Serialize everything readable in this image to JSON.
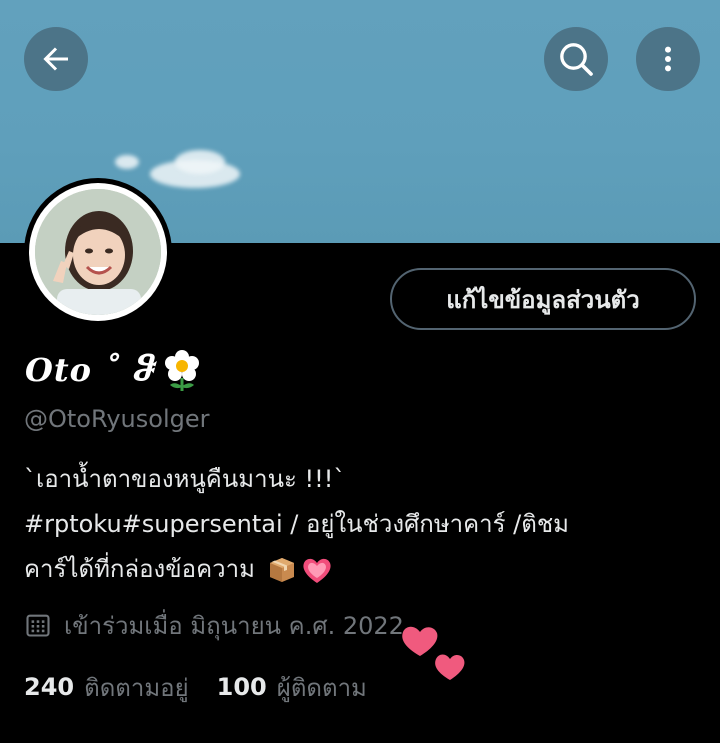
{
  "header": {
    "back_icon": "arrow-left-icon",
    "search_icon": "search-icon",
    "more_icon": "more-vertical-icon",
    "banner_color": "#62a1bd"
  },
  "profile": {
    "display_name": "Oto ˚ ჵ",
    "display_name_emoji": "white-flower-emoji",
    "handle": "@OtoRyusolger",
    "edit_button_label": "แก้ไขข้อมูลส่วนตัว"
  },
  "bio": {
    "line1": "`เอาน้ำตาของหนูคืนมานะ !!!`",
    "line2": "#rptoku#supersentai / อยู่ในช่วงศึกษาคาร์ /ติชม",
    "line3": "คาร์ได้ที่กล่องข้อความ",
    "line3_emojis": [
      "package-emoji",
      "pink-heart-emoji"
    ]
  },
  "joined": {
    "icon": "calendar-icon",
    "text": "เข้าร่วมเมื่อ มิถุนายน ค.ศ. 2022"
  },
  "stats": {
    "following_count": "240",
    "following_label": "ติดตามอยู่",
    "followers_count": "100",
    "followers_label": "ผู้ติดตาม"
  },
  "colors": {
    "background": "#000000",
    "primary_text": "#e7e9ea",
    "secondary_text": "#71767b",
    "border": "#536471",
    "sticker_heart": "#f05a7e"
  }
}
